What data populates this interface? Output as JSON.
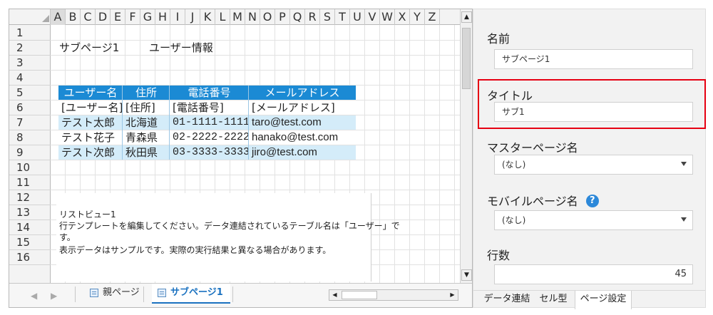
{
  "sheet": {
    "columns": [
      "A",
      "B",
      "C",
      "D",
      "E",
      "F",
      "G",
      "H",
      "I",
      "J",
      "K",
      "L",
      "M",
      "N",
      "O",
      "P",
      "Q",
      "R",
      "S",
      "T",
      "U",
      "V",
      "W",
      "X",
      "Y",
      "Z"
    ],
    "rows": [
      "1",
      "2",
      "3",
      "4",
      "5",
      "6",
      "7",
      "8",
      "9",
      "10",
      "11",
      "12",
      "13",
      "14",
      "15",
      "16"
    ],
    "page_name": "サブページ1",
    "page_title": "ユーザー情報",
    "table": {
      "headers": [
        "ユーザー名",
        "住所",
        "電話番号",
        "メールアドレス"
      ],
      "template": [
        "[ユーザー名]",
        "[住所]",
        "[電話番号]",
        "[メールアドレス]"
      ],
      "rows": [
        [
          "テスト太郎",
          "北海道",
          "01-1111-1111",
          "taro@test.com"
        ],
        [
          "テスト花子",
          "青森県",
          "02-2222-2222",
          "hanako@test.com"
        ],
        [
          "テスト次郎",
          "秋田県",
          "03-3333-3333",
          "jiro@test.com"
        ]
      ]
    },
    "listview": {
      "name": "リストビュー1",
      "line1": "行テンプレートを編集してください。データ連結されているテーブル名は「ユーザー」で",
      "line2": "す。",
      "line3": "表示データはサンプルです。実際の実行結果と異なる場合があります。"
    }
  },
  "tabs": {
    "parent": "親ページ",
    "sub": "サブページ1"
  },
  "panel": {
    "name_label": "名前",
    "name_value": "サブページ1",
    "title_label": "タイトル",
    "title_value": "サブ1",
    "master_label": "マスターページ名",
    "master_value": "(なし)",
    "mobile_label": "モバイルページ名",
    "mobile_value": "(なし)",
    "rows_label": "行数",
    "rows_value": "45",
    "tabs": [
      "データ連結",
      "セル型",
      "ページ設定"
    ],
    "active_tab": "ページ設定"
  },
  "colors": {
    "header_blue": "#1b8ad4",
    "band_blue": "#d4ecf9",
    "highlight_red": "#e60012",
    "help_blue": "#2c88d9"
  }
}
